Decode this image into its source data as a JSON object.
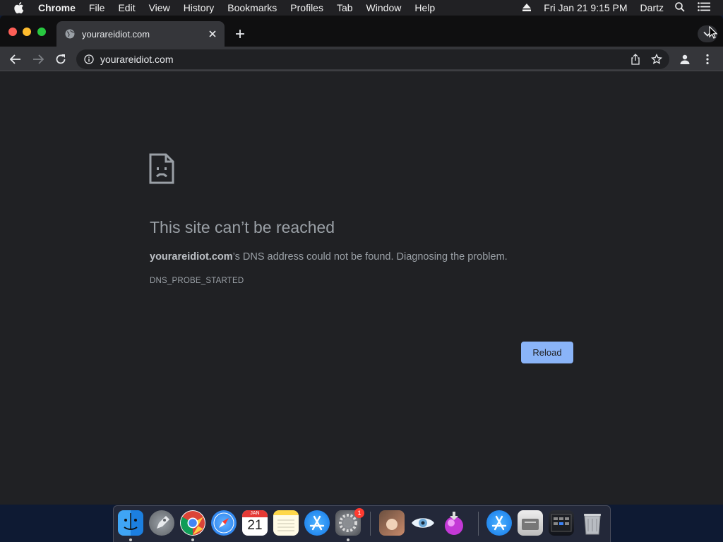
{
  "menubar": {
    "app_name": "Chrome",
    "items": [
      "File",
      "Edit",
      "View",
      "History",
      "Bookmarks",
      "Profiles",
      "Tab",
      "Window",
      "Help"
    ],
    "clock": "Fri Jan 21  9:15 PM",
    "user": "Dartz"
  },
  "tab": {
    "title": "yourareidiot.com"
  },
  "omnibox": {
    "url": "yourareidiot.com"
  },
  "error": {
    "title": "This site can’t be reached",
    "domain": "yourareidiot.com",
    "message_suffix": "’s DNS address could not be found. Diagnosing the problem.",
    "code": "DNS_PROBE_STARTED",
    "reload_label": "Reload"
  },
  "dock": {
    "calendar_month": "JAN",
    "calendar_day": "21",
    "settings_badge": "1",
    "icons": [
      "finder-icon",
      "launchpad-icon",
      "chrome-icon",
      "safari-icon",
      "calendar-icon",
      "notes-icon",
      "app-store-icon",
      "system-preferences-icon",
      "photo-app-icon",
      "preview-eye-icon",
      "pink-orb-app-icon",
      "app-store-downloads-icon",
      "disk-utility-icon",
      "screenshot-stack-icon",
      "trash-icon"
    ]
  },
  "colors": {
    "page_bg": "#202124",
    "accent": "#8ab4f8",
    "error_text": "#9aa0a6"
  }
}
